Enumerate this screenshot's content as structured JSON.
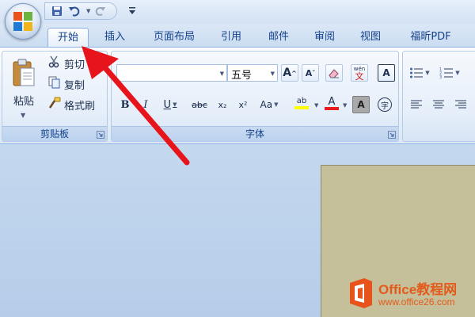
{
  "quick_access": {
    "icons": [
      "save-icon",
      "undo-icon",
      "redo-icon",
      "customize-icon"
    ]
  },
  "tabs": [
    {
      "label": "开始",
      "active": true
    },
    {
      "label": "插入",
      "active": false
    },
    {
      "label": "页面布局",
      "active": false
    },
    {
      "label": "引用",
      "active": false
    },
    {
      "label": "邮件",
      "active": false
    },
    {
      "label": "审阅",
      "active": false
    },
    {
      "label": "视图",
      "active": false
    },
    {
      "label": "福昕PDF",
      "active": false
    }
  ],
  "clipboard": {
    "group_label": "剪贴板",
    "paste": "粘贴",
    "cut": "剪切",
    "copy": "复制",
    "format_painter": "格式刷"
  },
  "font": {
    "group_label": "字体",
    "font_name": "",
    "font_size": "五号",
    "grow": "A",
    "shrink": "A",
    "wen": "wén",
    "wen_char": "文",
    "border_a": "A",
    "bold": "B",
    "italic": "I",
    "underline": "U",
    "strike": "abc",
    "subscript": "x₂",
    "superscript": "x²",
    "change_case": "Aa",
    "highlight": "ab",
    "font_color": "A",
    "shading_a": "A",
    "enclose": "字"
  },
  "watermark": {
    "title": "Office教程网",
    "url": "www.office26.com"
  },
  "colors": {
    "accent_red": "#e8141b",
    "font_color_bar": "#e81c1c",
    "highlight_bar": "#ffff00",
    "ribbon_text": "#15428b",
    "watermark_orange": "#e35a1a"
  }
}
